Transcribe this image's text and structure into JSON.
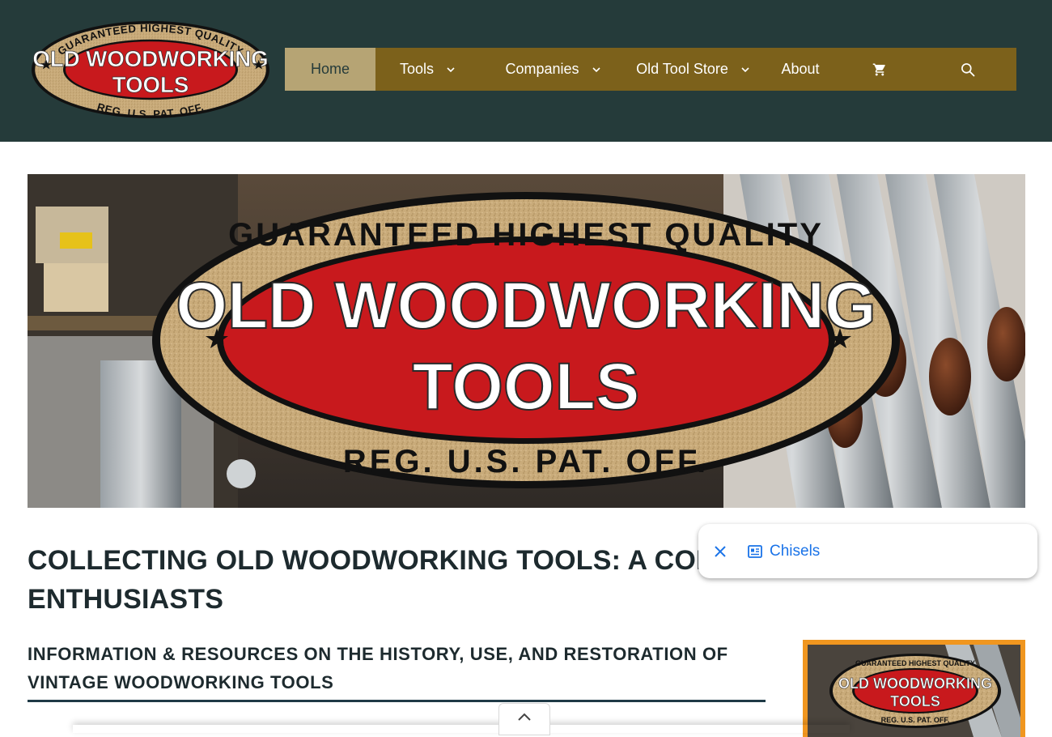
{
  "header": {
    "logo": {
      "arc_top": "GUARANTEED HIGHEST QUALITY",
      "line1": "OLD WOODWORKING",
      "line2": "TOOLS",
      "arc_bottom": "REG. U.S. PAT. OFF."
    },
    "nav": {
      "home": "Home",
      "tools": "Tools",
      "companies": "Companies",
      "store": "Old Tool Store",
      "about": "About"
    }
  },
  "icons": {
    "cart": "cart-icon",
    "search": "search-icon",
    "chevron": "chevron-down-icon",
    "close": "close-icon",
    "doc": "article-icon",
    "up": "chevron-up-icon"
  },
  "main": {
    "headline_line1": "COLLECTING OLD WOODWORKING TOOLS: A COMPL",
    "headline_line2": "ENTHUSIASTS",
    "subhead_line1": "INFORMATION & RESOURCES ON THE HISTORY, USE, AND RESTORATION OF",
    "subhead_line2": "VINTAGE WOODWORKING TOOLS"
  },
  "popup": {
    "link_label": "Chisels"
  },
  "colors": {
    "topbar": "#253b3a",
    "nav": "#7c611b",
    "nav_active": "#b6a474",
    "logo_red": "#c8191d",
    "logo_cork": "#c9ab7a",
    "text_dark": "#1d2a2e",
    "accent_orange": "#f0961f",
    "link_blue": "#1a73e8"
  }
}
